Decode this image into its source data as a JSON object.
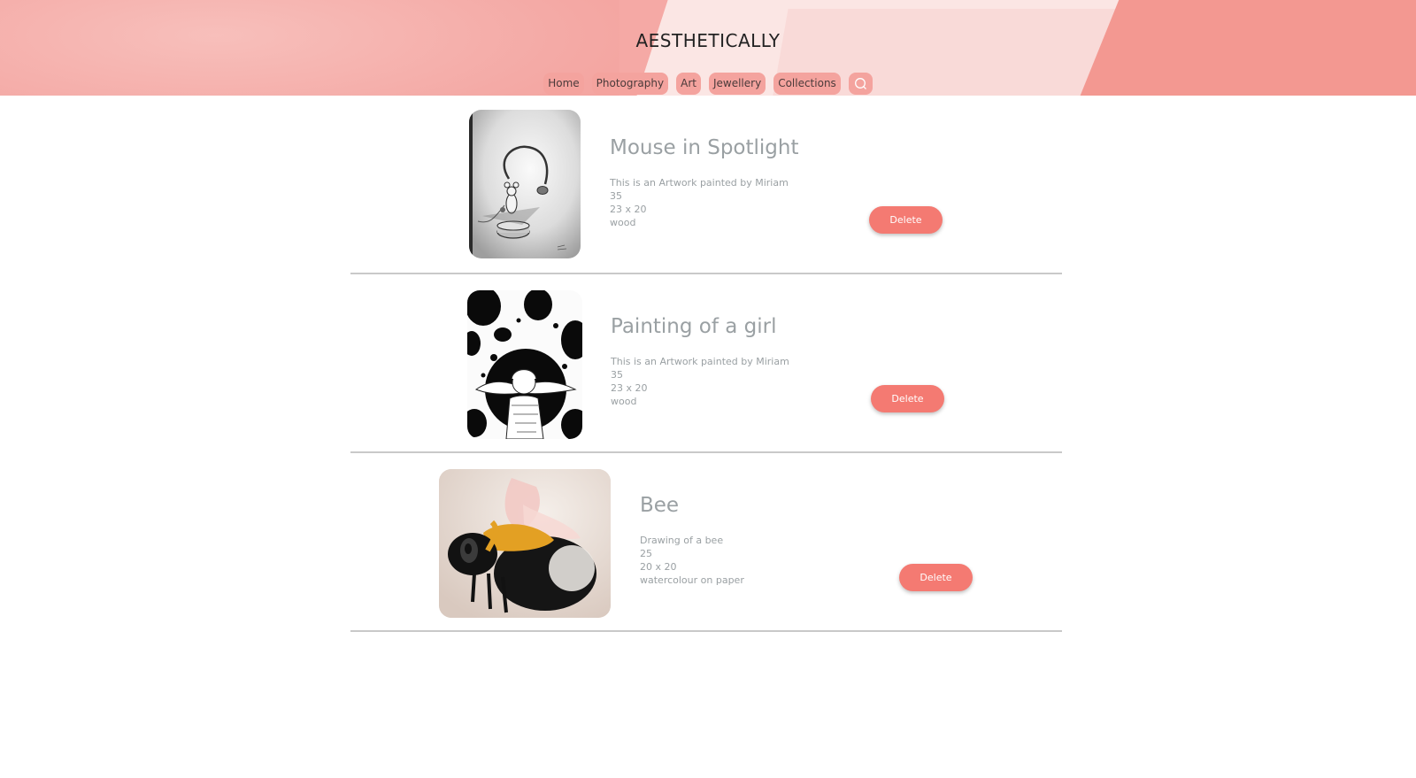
{
  "site": {
    "brand": "AESTHETICALLY"
  },
  "nav": {
    "items": [
      "Home",
      "Photography",
      "Art",
      "Jewellery",
      "Collections"
    ],
    "search_icon": "search-icon"
  },
  "colors": {
    "header_bg": "#f5a9a5",
    "nav_pill": "#f4a39e",
    "delete_button": "#f47a72",
    "text_muted": "#9aa0a3",
    "divider": "#c9c9c9"
  },
  "artworks": [
    {
      "title": "Mouse in Spotlight",
      "description": "This is an Artwork painted by Miriam",
      "price": "35",
      "size": "23 x 20",
      "material": "wood",
      "delete_label": "Delete"
    },
    {
      "title": "Painting of a girl",
      "description": "This is an Artwork painted by Miriam",
      "price": "35",
      "size": "23 x 20",
      "material": "wood",
      "delete_label": "Delete"
    },
    {
      "title": "Bee",
      "description": "Drawing of a bee",
      "price": "25",
      "size": "20 x 20",
      "material": "watercolour on paper",
      "delete_label": "Delete"
    }
  ]
}
